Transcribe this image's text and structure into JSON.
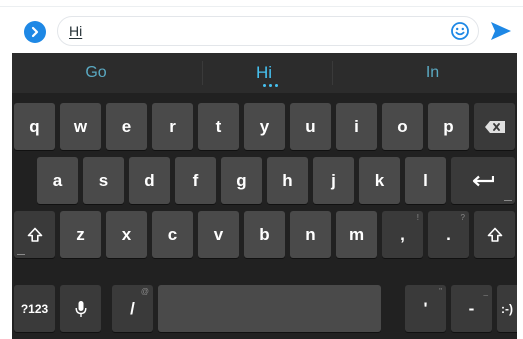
{
  "compose": {
    "text": "Hi",
    "accent_color": "#1e88e5"
  },
  "suggestions": [
    "Go",
    "Hi",
    "In"
  ],
  "keyboard": {
    "row1": [
      "q",
      "w",
      "e",
      "r",
      "t",
      "y",
      "u",
      "i",
      "o",
      "p"
    ],
    "row2": [
      "a",
      "s",
      "d",
      "f",
      "g",
      "h",
      "j",
      "k",
      "l"
    ],
    "row3": [
      "z",
      "x",
      "c",
      "v",
      "b",
      "n",
      "m"
    ],
    "row3_punct": [
      ",",
      "."
    ],
    "row3_hints": [
      "!",
      "?"
    ],
    "symbols_label": "?123",
    "slash_label": "/",
    "slash_hint": "@",
    "apostrophe_label": "'",
    "apostrophe_hint": "\"",
    "dash_label": "-",
    "dash_hint": "_",
    "emoticon_label": ":-)"
  },
  "icons": {
    "expand": "chevron-right-circle-icon",
    "emoji": "smiley-icon",
    "send": "send-icon",
    "backspace": "backspace-icon",
    "enter": "enter-icon",
    "shift": "shift-icon",
    "mic": "microphone-icon"
  }
}
